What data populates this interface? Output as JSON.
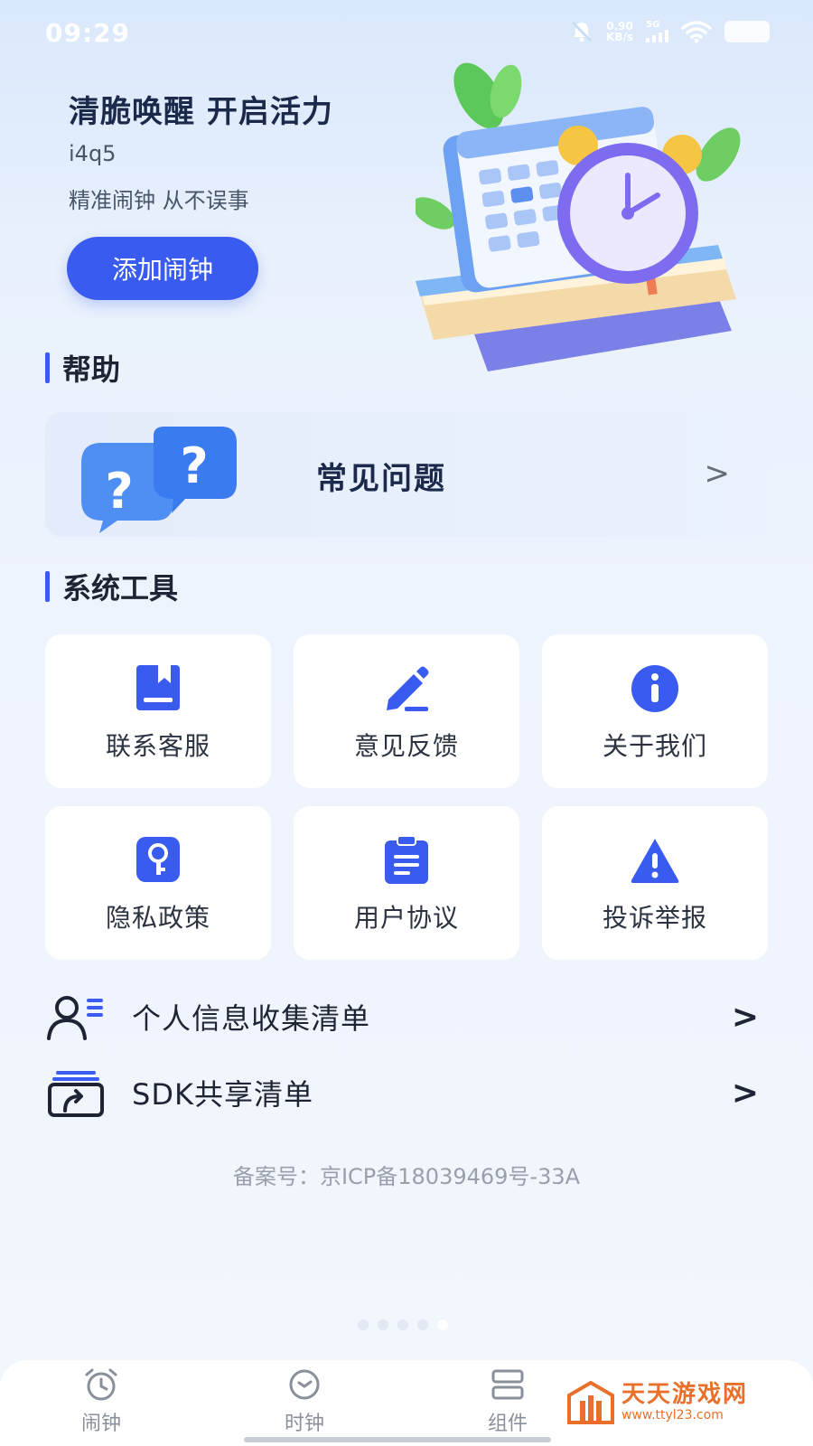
{
  "status_bar": {
    "time": "09:29",
    "speed_value": "0.90",
    "speed_unit": "KB/s",
    "network": "5G"
  },
  "hero": {
    "title": "清脆唤醒 开启活力",
    "code": "i4q5",
    "subtitle": "精准闹钟 从不误事",
    "add_button": "添加闹钟"
  },
  "help": {
    "heading": "帮助",
    "faq_label": "常见问题",
    "chevron": ">"
  },
  "tools": {
    "heading": "系统工具",
    "items": [
      {
        "label": "联系客服",
        "icon": "book-icon"
      },
      {
        "label": "意见反馈",
        "icon": "pen-icon"
      },
      {
        "label": "关于我们",
        "icon": "info-icon"
      },
      {
        "label": "隐私政策",
        "icon": "key-icon"
      },
      {
        "label": "用户协议",
        "icon": "clipboard-icon"
      },
      {
        "label": "投诉举报",
        "icon": "warning-icon"
      }
    ]
  },
  "lists": [
    {
      "label": "个人信息收集清单",
      "icon": "user-list-icon",
      "chevron": ">"
    },
    {
      "label": "SDK共享清单",
      "icon": "share-box-icon",
      "chevron": ">"
    }
  ],
  "icp": "备案号：京ICP备18039469号-33A",
  "tabbar": {
    "items": [
      {
        "label": "闹钟",
        "icon": "alarm-icon"
      },
      {
        "label": "时钟",
        "icon": "clock-icon"
      },
      {
        "label": "组件",
        "icon": "widget-icon"
      }
    ]
  },
  "watermark": {
    "title": "天天游戏网",
    "url": "www.ttyl23.com"
  },
  "colors": {
    "accent": "#3a5bf0",
    "watermark": "#e8702a"
  }
}
